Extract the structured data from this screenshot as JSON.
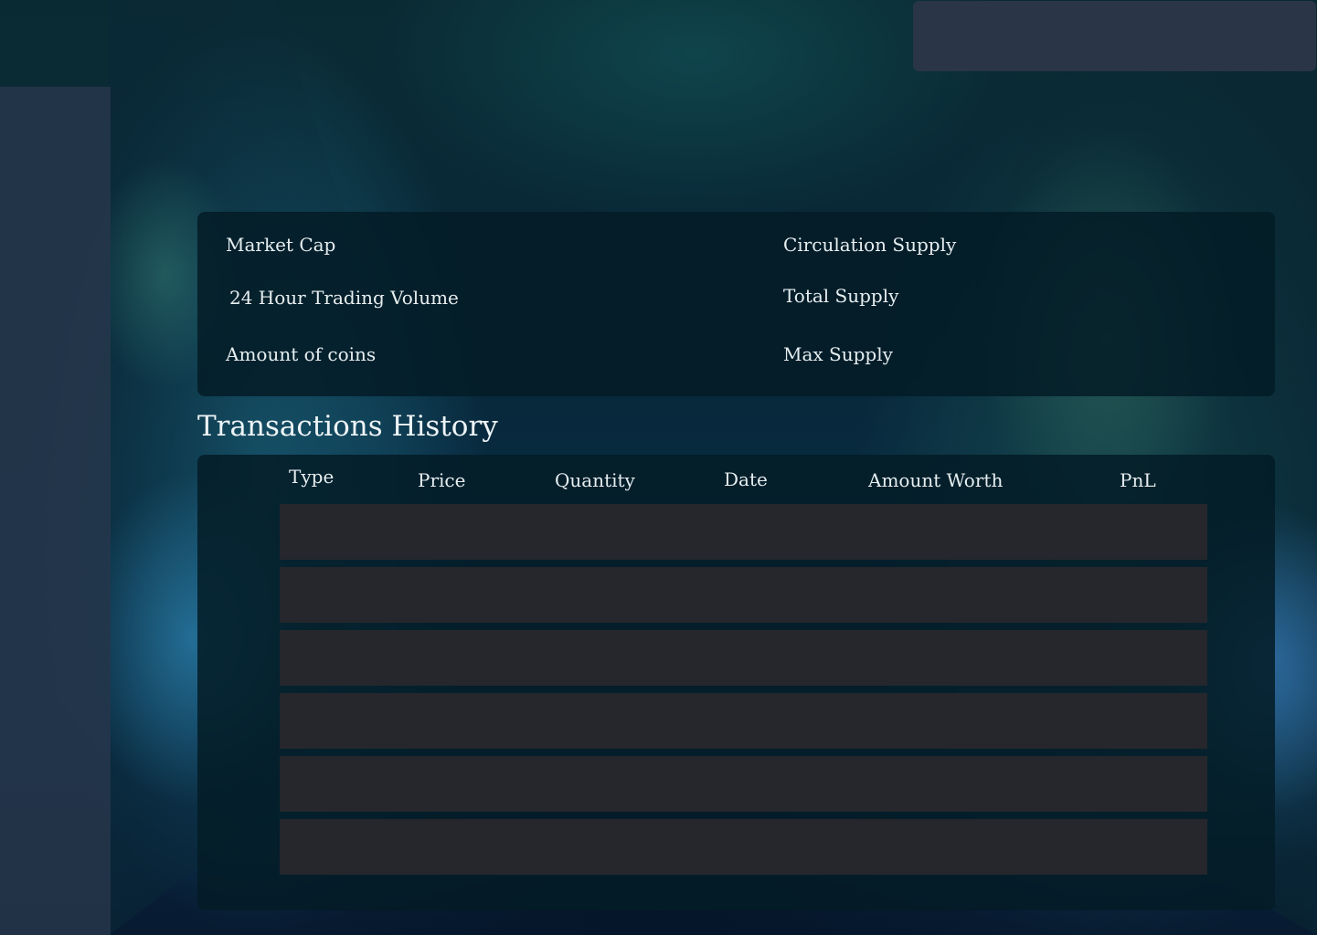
{
  "stats": {
    "market_cap_label": "Market Cap",
    "trading_volume_label": "24 Hour Trading Volume",
    "amount_coins_label": "Amount of coins",
    "circulation_supply_label": "Circulation Supply",
    "total_supply_label": "Total Supply",
    "max_supply_label": "Max Supply"
  },
  "transactions": {
    "title": "Transactions History",
    "columns": [
      "Type",
      "Price",
      "Quantity",
      "Date",
      "Amount Worth",
      "PnL"
    ],
    "row_count": 6
  },
  "colors": {
    "panel": "#041c26",
    "row": "#26272c",
    "sidebar": "#26364a",
    "topbar": "#2a3547"
  }
}
